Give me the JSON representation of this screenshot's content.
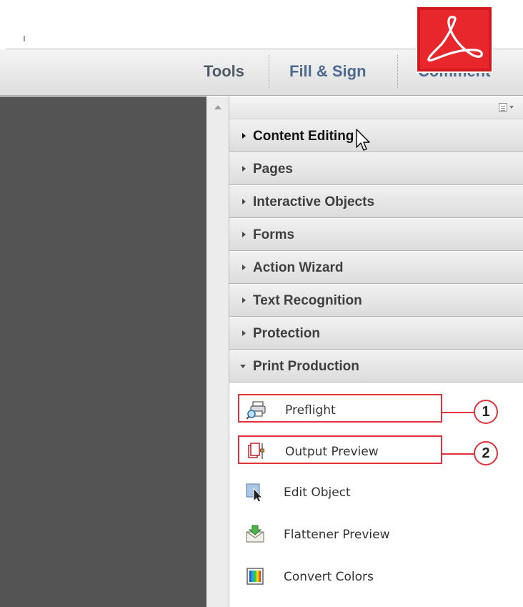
{
  "toolbar": {
    "tabs": [
      {
        "label": "Tools"
      },
      {
        "label": "Fill & Sign"
      },
      {
        "label": "Comment"
      }
    ],
    "logo_icon": "adobe-acrobat-logo"
  },
  "panel": {
    "options_icon": "panel-options-icon",
    "sections": [
      {
        "label": "Content Editing",
        "expanded": false
      },
      {
        "label": "Pages",
        "expanded": false
      },
      {
        "label": "Interactive Objects",
        "expanded": false
      },
      {
        "label": "Forms",
        "expanded": false
      },
      {
        "label": "Action Wizard",
        "expanded": false
      },
      {
        "label": "Text Recognition",
        "expanded": false
      },
      {
        "label": "Protection",
        "expanded": false
      },
      {
        "label": "Print Production",
        "expanded": true
      }
    ],
    "print_production_items": [
      {
        "label": "Preflight",
        "icon": "preflight-icon",
        "callout": "1"
      },
      {
        "label": "Output Preview",
        "icon": "output-preview-icon",
        "callout": "2"
      },
      {
        "label": "Edit Object",
        "icon": "edit-object-icon"
      },
      {
        "label": "Flattener Preview",
        "icon": "flattener-preview-icon"
      },
      {
        "label": "Convert Colors",
        "icon": "convert-colors-icon"
      }
    ]
  },
  "colors": {
    "highlight": "#e0323a",
    "logo_red": "#e8272c",
    "doc_area": "#545454"
  }
}
